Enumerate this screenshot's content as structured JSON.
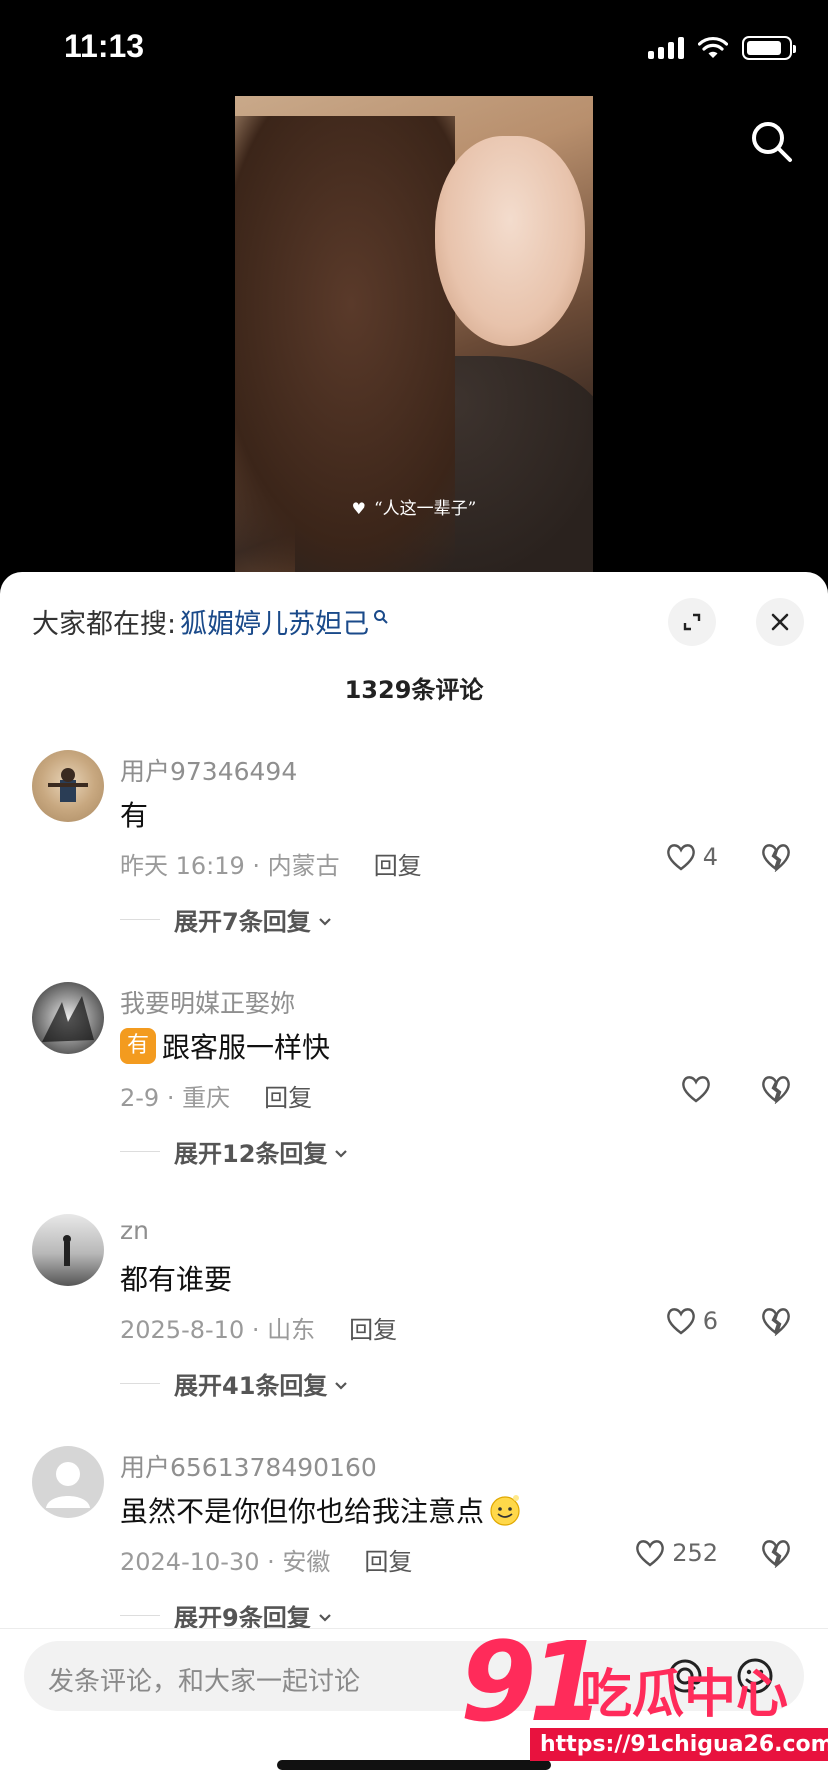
{
  "status": {
    "time": "11:13",
    "battery_level": 0.85
  },
  "video": {
    "caption": "“人这一辈子”"
  },
  "panel": {
    "hot_search_prefix": "大家都在搜:",
    "hot_search_term": "狐媚婷儿苏妲己",
    "comment_count": "1329条评论"
  },
  "comments": [
    {
      "user": "用户97346494",
      "text": "有",
      "time_loc": "昨天 16:19 · 内蒙古",
      "reply": "回复",
      "likes": "4",
      "expand": "展开7条回复"
    },
    {
      "user": "我要明媒正娶妳",
      "badge": "有",
      "text": "跟客服一样快",
      "time_loc": "2-9 · 重庆",
      "reply": "回复",
      "likes": "",
      "expand": "展开12条回复"
    },
    {
      "user": "zn",
      "text": "都有谁要",
      "time_loc": "2025-8-10 · 山东",
      "reply": "回复",
      "likes": "6",
      "expand": "展开41条回复"
    },
    {
      "user": "用户6561378490160",
      "text": "虽然不是你但你也给我注意点",
      "time_loc": "2024-10-30 · 安徽",
      "reply": "回复",
      "likes": "252",
      "expand": "展开9条回复"
    }
  ],
  "input": {
    "placeholder": "发条评论，和大家一起讨论"
  },
  "watermark": {
    "logo": "91",
    "name": "吃瓜中心",
    "url": "https://91chigua26.com"
  }
}
